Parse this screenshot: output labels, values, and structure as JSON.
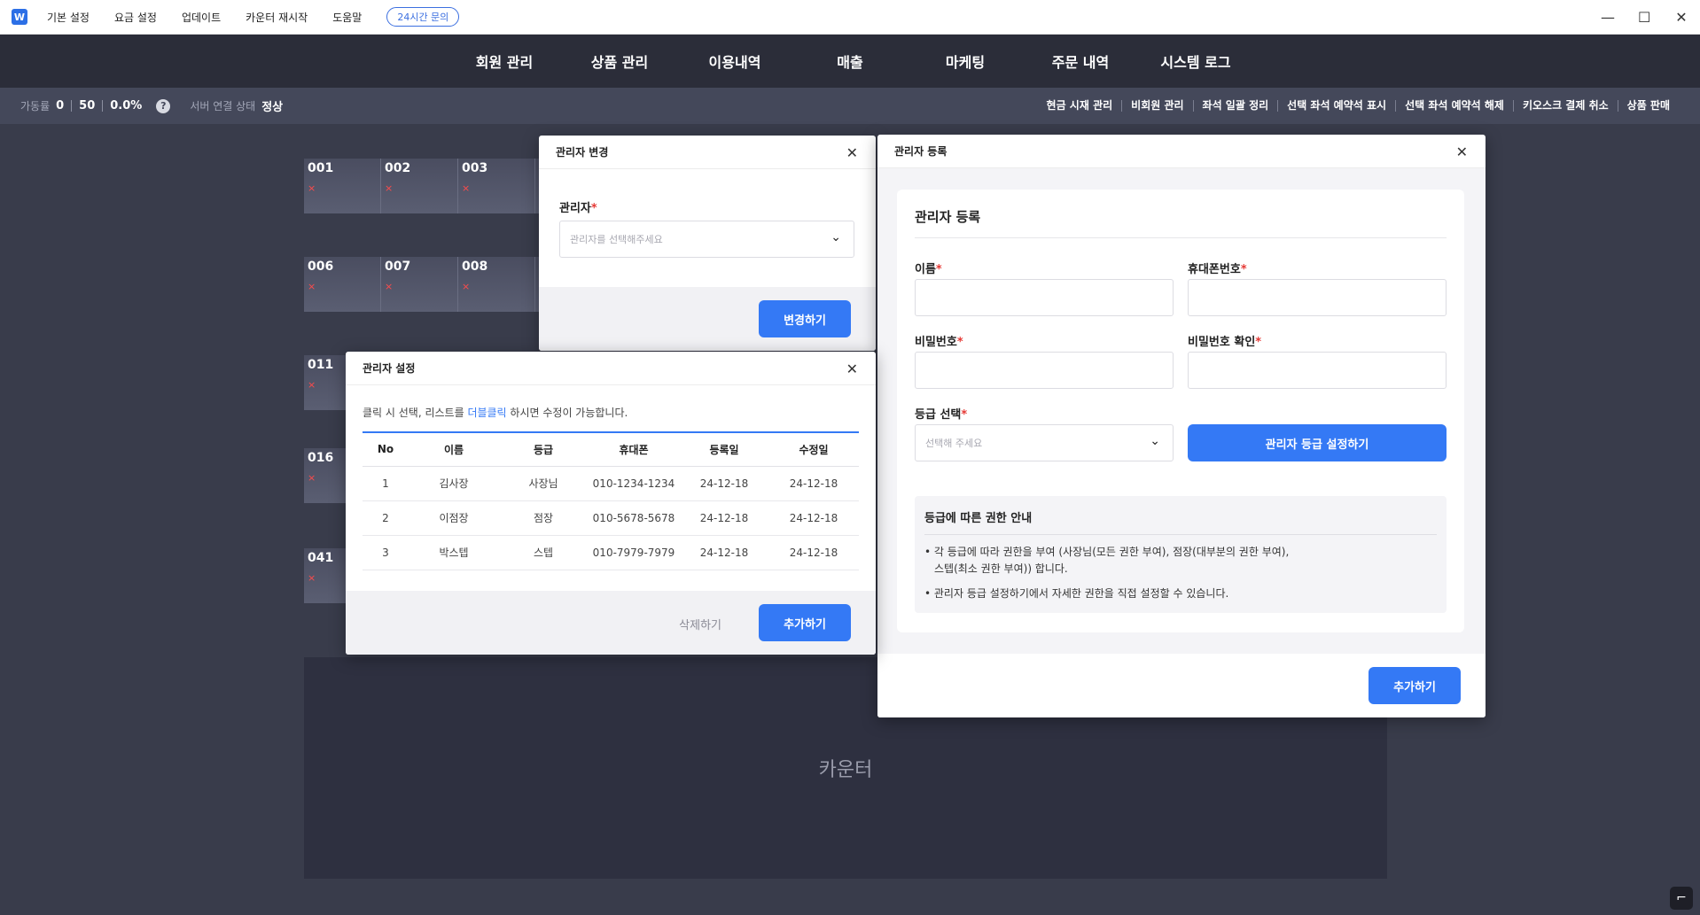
{
  "titlebar": {
    "logo": "W",
    "menu": [
      "기본 설정",
      "요금 설정",
      "업데이트",
      "카운터 재시작",
      "도움말"
    ],
    "inquiry": "24시간 문의",
    "controls": [
      "—",
      "☐",
      "✕"
    ]
  },
  "nav": [
    "회원 관리",
    "상품 관리",
    "이용내역",
    "매출",
    "마케팅",
    "주문 내역",
    "시스템 로그"
  ],
  "status": {
    "usage_label": "가동률",
    "used": "0",
    "total": "50",
    "rate": "0.0%",
    "help": "?",
    "server_label": "서버 연결 상태",
    "server_value": "정상",
    "links": [
      "현금 시재 관리",
      "비회원 관리",
      "좌석 일괄 정리",
      "선택 좌석 예약석 표시",
      "선택 좌석 예약석 해제",
      "키오스크 결제 취소",
      "상품 판매"
    ]
  },
  "seats": [
    "001",
    "002",
    "003",
    "006",
    "007",
    "008",
    "011",
    "016",
    "041"
  ],
  "seat_mark": "×",
  "counter_label": "카운터",
  "modal_change": {
    "title": "관리자 변경",
    "field_label": "관리자",
    "required": "*",
    "placeholder": "관리자를 선택해주세요",
    "button": "변경하기",
    "close": "✕"
  },
  "modal_settings": {
    "title": "관리자 설정",
    "hint_before": "클릭 시 선택, 리스트를 ",
    "hint_link": "더블클릭",
    "hint_after": " 하시면 수정이 가능합니다.",
    "columns": [
      "No",
      "이름",
      "등급",
      "휴대폰",
      "등록일",
      "수정일"
    ],
    "rows": [
      [
        "1",
        "김사장",
        "사장님",
        "010-1234-1234",
        "24-12-18",
        "24-12-18"
      ],
      [
        "2",
        "이점장",
        "점장",
        "010-5678-5678",
        "24-12-18",
        "24-12-18"
      ],
      [
        "3",
        "박스텝",
        "스텝",
        "010-7979-7979",
        "24-12-18",
        "24-12-18"
      ]
    ],
    "delete_button": "삭제하기",
    "add_button": "추가하기",
    "close": "✕"
  },
  "modal_register": {
    "title": "관리자 등록",
    "section_title": "관리자 등록",
    "name_label": "이름",
    "phone_label": "휴대폰번호",
    "password_label": "비밀번호",
    "password_confirm_label": "비밀번호 확인",
    "grade_label": "등급 선택",
    "grade_placeholder": "선택해 주세요",
    "grade_setting_button": "관리자 등급 설정하기",
    "info_title": "등급에 따른 권한 안내",
    "info_line1": "• 각 등급에 따라 권한을 부여 (사장님(모든 권한 부여), 점장(대부분의 권한 부여),",
    "info_line1b": "스텝(최소 권한 부여)) 합니다.",
    "info_line2": "• 관리자 등급 설정하기에서 자세한 권한을 직접 설정할 수 있습니다.",
    "add_button": "추가하기",
    "close": "✕",
    "required": "*"
  },
  "corner_icon": "⌐"
}
